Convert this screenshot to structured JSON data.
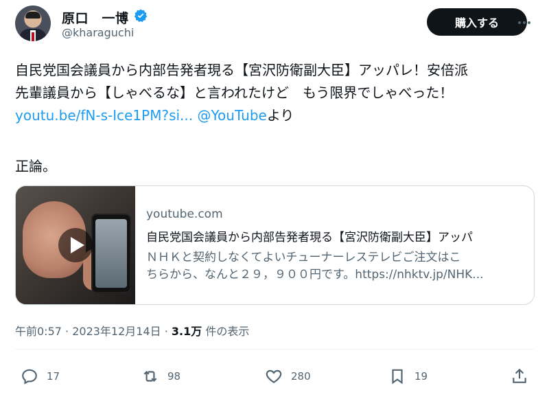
{
  "author": {
    "name": "原口　一博",
    "handle": "@kharaguchi"
  },
  "header": {
    "buy_label": "購入する"
  },
  "tweet": {
    "line1": "自民党国会議員から内部告発者現る【宮沢防衛副大臣】アッパレ！安倍派",
    "line2": "先輩議員から【しゃべるな】と言われたけど　もう限界でしゃべった！",
    "link_text": "youtu.be/fN-s-Ice1PM?si...",
    "mention": "@YouTube",
    "suffix": "より",
    "comment": "正論。"
  },
  "card": {
    "domain": "youtube.com",
    "title": "自民党国会議員から内部告発者現る【宮沢防衛副大臣】アッパ",
    "desc_line1": "ＮＨＫと契約しなくてよいチューナーレステレビご注文はこ",
    "desc_line2": "ちらから、なんと２９，９００円です。https://nhktv.jp/NHK..."
  },
  "meta": {
    "time": "午前0:57",
    "sep1": " · ",
    "date": "2023年12月14日",
    "sep2": " · ",
    "views": "3.1万",
    "views_label": " 件の表示"
  },
  "actions": {
    "replies": "17",
    "retweets": "98",
    "likes": "280",
    "bookmarks": "19"
  },
  "colors": {
    "link": "#1d9bf0",
    "verified": "#1d9bf0",
    "button_bg": "#0f1419"
  }
}
